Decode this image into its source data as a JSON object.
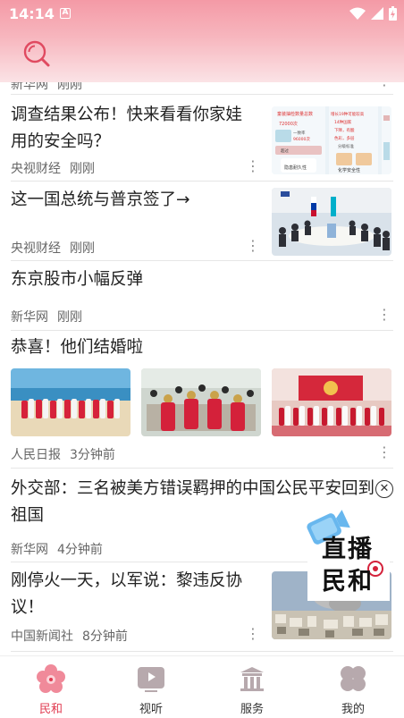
{
  "status_bar": {
    "time": "14:14",
    "notif_letter": "A"
  },
  "header": {
    "search_icon": "search-icon"
  },
  "articles": [
    {
      "title": "",
      "source": "新华网",
      "time": "刚刚"
    },
    {
      "title_line1": "调查结果公布！快来看看你家娃",
      "title_line2": "用的安全吗？",
      "source": "央视财经",
      "time": "刚刚",
      "thumb_texts": [
        "童装抽检数量总数",
        "72000次",
        "一致率",
        "96000次",
        "超过",
        "增长19种可能较高",
        "14种国家",
        "下降，有酸",
        "色彩，多层",
        "分级标准",
        "隐患耐久性",
        "化学安全性"
      ]
    },
    {
      "title": "这一国总统与普京签了→",
      "source": "央视财经",
      "time": "刚刚"
    },
    {
      "title": "东京股市小幅反弹",
      "source": "新华网",
      "time": "刚刚"
    },
    {
      "title": "恭喜！他们结婚啦",
      "source": "人民日报",
      "time": "3分钟前"
    },
    {
      "title_line1": "外交部：三名被美方错误羁押的中国公民平安回到",
      "title_line2": "祖国",
      "source": "新华网",
      "time": "4分钟前"
    },
    {
      "title_line1": "刚停火一天，以军说：黎违反协",
      "title_line2": "议！",
      "source": "中国新闻社",
      "time": "8分钟前"
    }
  ],
  "floating_ad": {
    "line1": "直播",
    "line2": "民和"
  },
  "tabbar": [
    {
      "label": "民和",
      "icon": "flower-icon",
      "active": true
    },
    {
      "label": "视听",
      "icon": "music-video-icon",
      "active": false
    },
    {
      "label": "服务",
      "icon": "building-icon",
      "active": false
    },
    {
      "label": "我的",
      "icon": "clover-icon",
      "active": false
    }
  ],
  "colors": {
    "accent": "#e0394f",
    "header_top": "#f49aa6",
    "header_bottom": "#fbe3e6"
  }
}
